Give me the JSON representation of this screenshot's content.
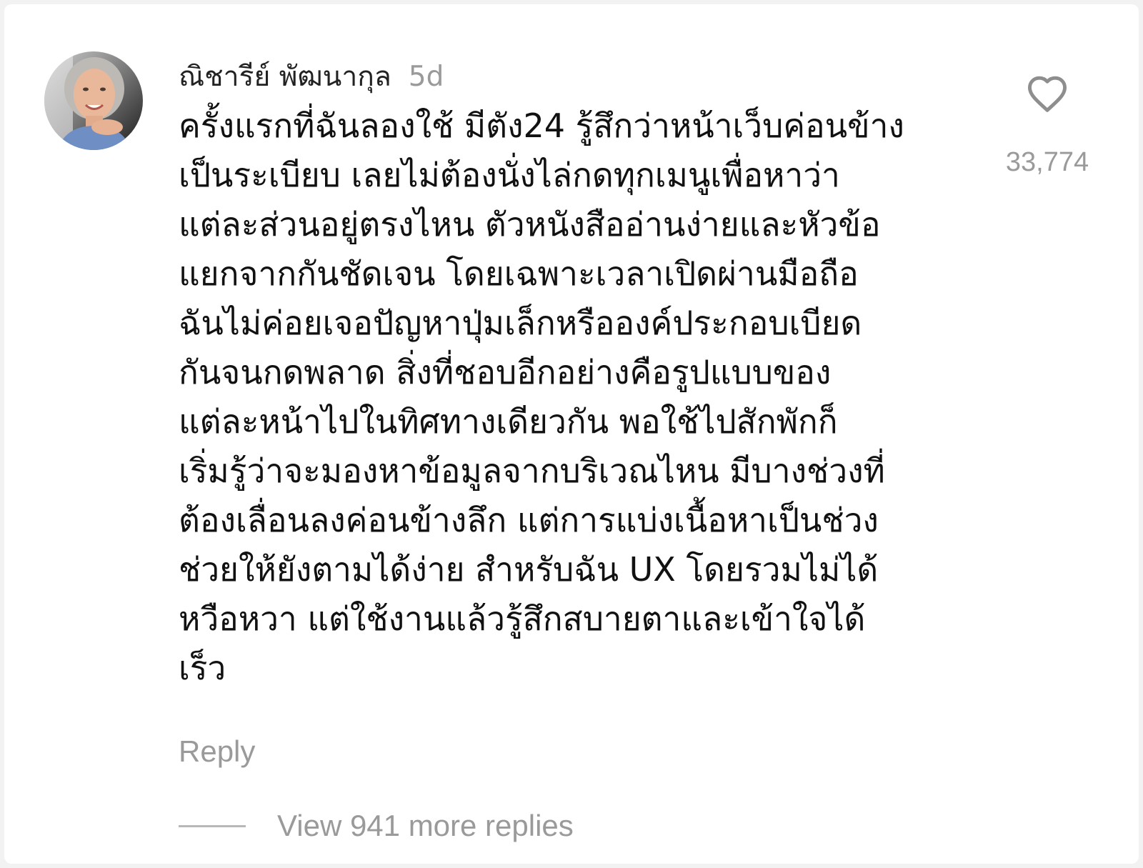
{
  "comment": {
    "author": "ณิชารีย์ พัฒนากุล",
    "time": "5d",
    "avatar_icon": "user-avatar-photo",
    "text": "ครั้งแรกที่ฉันลองใช้ มีตัง24 รู้สึกว่าหน้าเว็บค่อนข้าง\nเป็นระเบียบ เลยไม่ต้องนั่งไล่กดทุกเมนูเพื่อหาว่า\nแต่ละส่วนอยู่ตรงไหน ตัวหนังสืออ่านง่ายและหัวข้อ\nแยกจากกันชัดเจน โดยเฉพาะเวลาเปิดผ่านมือถือ\nฉันไม่ค่อยเจอปัญหาปุ่มเล็กหรือองค์ประกอบเบียด\nกันจนกดพลาด สิ่งที่ชอบอีกอย่างคือรูปแบบของ\nแต่ละหน้าไปในทิศทางเดียวกัน พอใช้ไปสักพักก็\nเริ่มรู้ว่าจะมองหาข้อมูลจากบริเวณไหน มีบางช่วงที่\nต้องเลื่อนลงค่อนข้างลึก แต่การแบ่งเนื้อหาเป็นช่วง\nช่วยให้ยังตามได้ง่าย สำหรับฉัน UX โดยรวมไม่ได้\nหวือหวา แต่ใช้งานแล้วรู้สึกสบายตาและเข้าใจได้\nเร็ว",
    "reply_label": "Reply",
    "view_replies_label": "View 941 more replies",
    "like_icon": "heart-icon",
    "like_count": "33,774"
  },
  "colors": {
    "text_primary": "#111111",
    "text_secondary": "#9a9a9a",
    "background": "#ffffff"
  }
}
